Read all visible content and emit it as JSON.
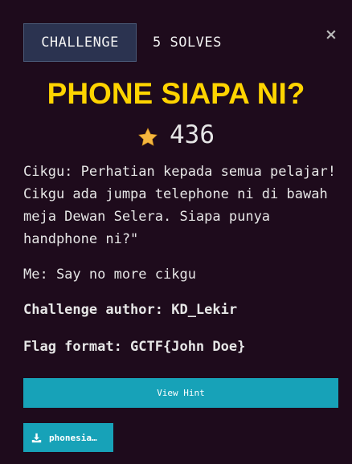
{
  "tabs": {
    "challenge_label": "CHALLENGE",
    "solves_label": "5 SOLVES"
  },
  "close_icon": "×",
  "challenge": {
    "title": "PHONE SIAPA NI?",
    "points": "436",
    "star_icon": "star-icon",
    "description": [
      "Cikgu: Perhatian kepada semua pelajar! Cikgu ada jumpa telephone ni di bawah meja Dewan Selera. Siapa punya handphone ni?\"",
      "Me: Say no more cikgu",
      "Challenge author: KD_Lekir",
      "Flag format: GCTF{John Doe}"
    ]
  },
  "hint_button_label": "View Hint",
  "file": {
    "icon": "download-icon",
    "label": "phonesia…"
  },
  "colors": {
    "background": "#1e0b1c",
    "title": "#ffd400",
    "button": "#17a2b8",
    "tab": "#2b3350"
  }
}
